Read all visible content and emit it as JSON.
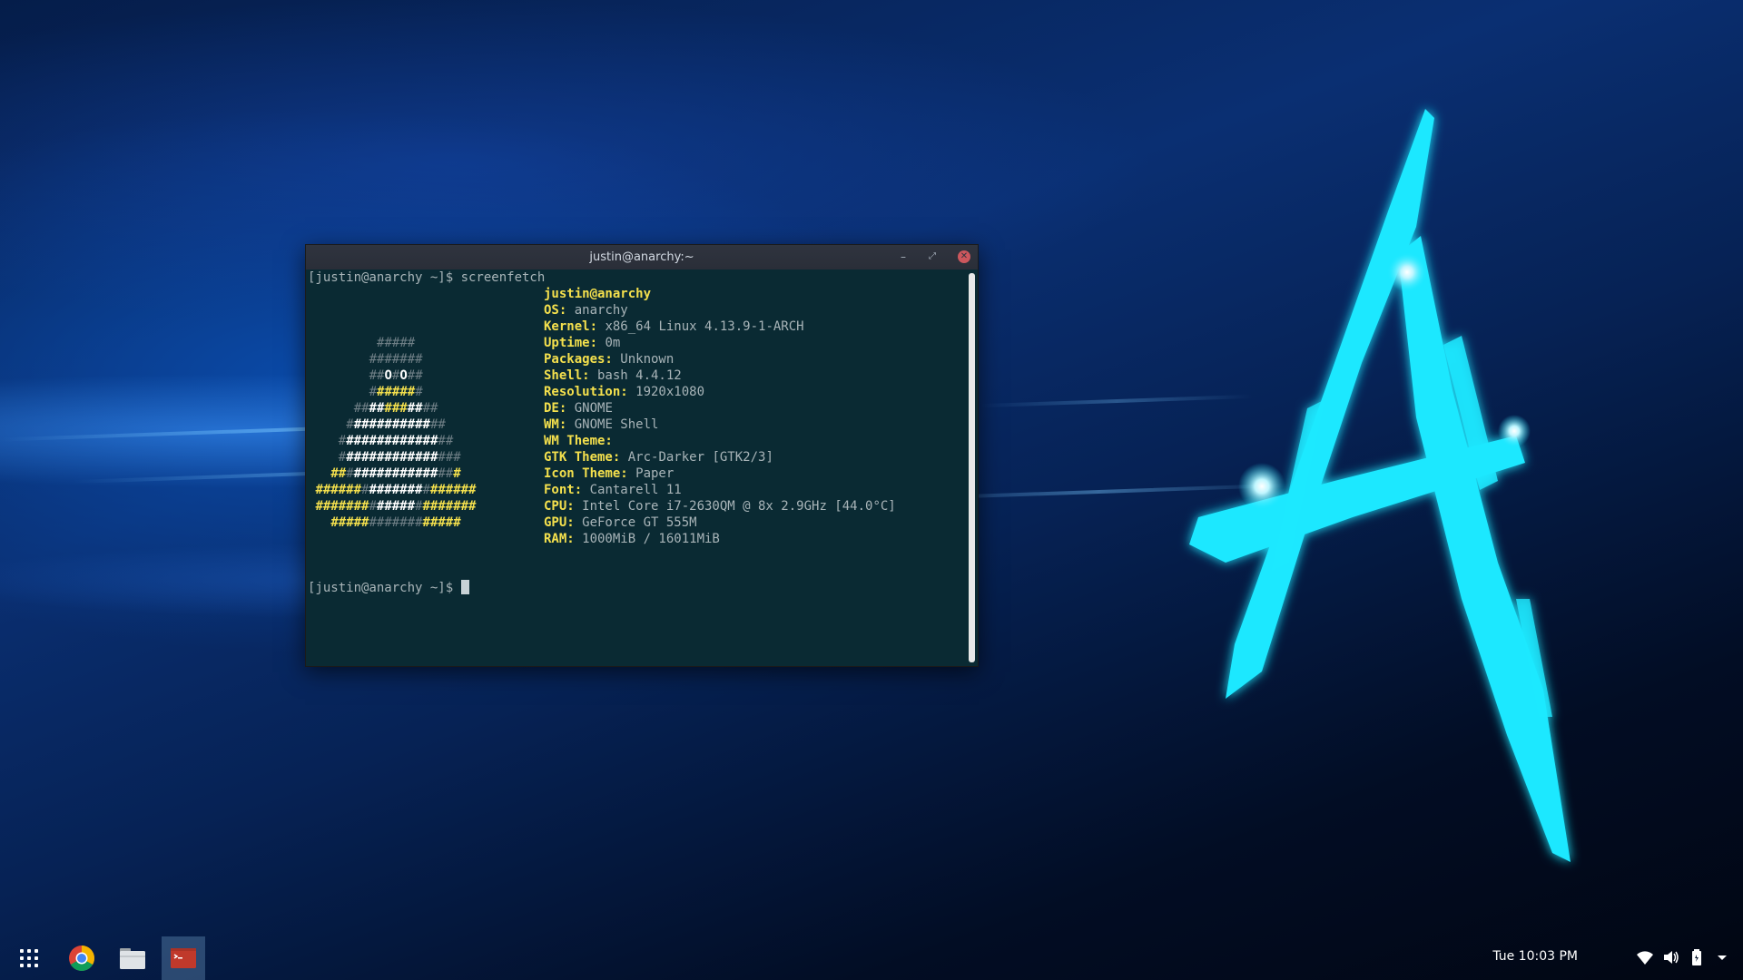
{
  "colors": {
    "terminal_bg": "#0a2a33",
    "titlebar_bg": "#2f343f",
    "key_yellow": "#f4e04d",
    "value_gray": "#a8b4b8",
    "close_red": "#cc575d",
    "logo_cyan": "#1ee8ff"
  },
  "terminal": {
    "title": "justin@anarchy:~",
    "prompt1": "[justin@anarchy ~]$ screenfetch",
    "prompt2": "[justin@anarchy ~]$ ",
    "header": "justin@anarchy",
    "info": [
      {
        "key": "OS:",
        "value": " anarchy"
      },
      {
        "key": "Kernel:",
        "value": " x86_64 Linux 4.13.9-1-ARCH"
      },
      {
        "key": "Uptime:",
        "value": " 0m"
      },
      {
        "key": "Packages:",
        "value": " Unknown"
      },
      {
        "key": "Shell:",
        "value": " bash 4.4.12"
      },
      {
        "key": "Resolution:",
        "value": " 1920x1080"
      },
      {
        "key": "DE:",
        "value": " GNOME"
      },
      {
        "key": "WM:",
        "value": " GNOME Shell"
      },
      {
        "key": "WM Theme:",
        "value": ""
      },
      {
        "key": "GTK Theme:",
        "value": " Arc-Darker [GTK2/3]"
      },
      {
        "key": "Icon Theme:",
        "value": " Paper"
      },
      {
        "key": "Font:",
        "value": " Cantarell 11"
      },
      {
        "key": "CPU:",
        "value": " Intel Core i7-2630QM @ 8x 2.9GHz [44.0°C]"
      },
      {
        "key": "GPU:",
        "value": " GeForce GT 555M"
      },
      {
        "key": "RAM:",
        "value": " 1000MiB / 16011MiB"
      }
    ],
    "logo": [
      {
        "indent": 9,
        "segments": [
          [
            "g",
            "#####"
          ]
        ]
      },
      {
        "indent": 8,
        "segments": [
          [
            "g",
            "#######"
          ]
        ]
      },
      {
        "indent": 8,
        "segments": [
          [
            "g",
            "##"
          ],
          [
            "w",
            "O"
          ],
          [
            "g",
            "#"
          ],
          [
            "w",
            "O"
          ],
          [
            "g",
            "##"
          ]
        ]
      },
      {
        "indent": 8,
        "segments": [
          [
            "g",
            "#"
          ],
          [
            "y",
            "#####"
          ],
          [
            "g",
            "#"
          ]
        ]
      },
      {
        "indent": 6,
        "segments": [
          [
            "g",
            "##"
          ],
          [
            "w",
            "##"
          ],
          [
            "y",
            "###"
          ],
          [
            "w",
            "##"
          ],
          [
            "g",
            "##"
          ]
        ]
      },
      {
        "indent": 5,
        "segments": [
          [
            "g",
            "#"
          ],
          [
            "w",
            "##########"
          ],
          [
            "g",
            "##"
          ]
        ]
      },
      {
        "indent": 4,
        "segments": [
          [
            "g",
            "#"
          ],
          [
            "w",
            "############"
          ],
          [
            "g",
            "##"
          ]
        ]
      },
      {
        "indent": 4,
        "segments": [
          [
            "g",
            "#"
          ],
          [
            "w",
            "############"
          ],
          [
            "g",
            "###"
          ]
        ]
      },
      {
        "indent": 3,
        "segments": [
          [
            "y",
            "##"
          ],
          [
            "g",
            "#"
          ],
          [
            "w",
            "###########"
          ],
          [
            "g",
            "##"
          ],
          [
            "y",
            "#"
          ]
        ]
      },
      {
        "indent": 1,
        "segments": [
          [
            "y",
            "######"
          ],
          [
            "g",
            "#"
          ],
          [
            "w",
            "#######"
          ],
          [
            "g",
            "#"
          ],
          [
            "y",
            "######"
          ]
        ]
      },
      {
        "indent": 1,
        "segments": [
          [
            "y",
            "#######"
          ],
          [
            "g",
            "#"
          ],
          [
            "w",
            "#####"
          ],
          [
            "g",
            "#"
          ],
          [
            "y",
            "#######"
          ]
        ]
      },
      {
        "indent": 3,
        "segments": [
          [
            "y",
            "#####"
          ],
          [
            "g",
            "#######"
          ],
          [
            "y",
            "#####"
          ]
        ]
      }
    ],
    "window_buttons": {
      "minimize": "–",
      "maximize": "⤢",
      "close": "✕"
    }
  },
  "taskbar": {
    "clock": "Tue 10:03 PM",
    "apps": [
      {
        "name": "app-grid",
        "icon": "grid-icon"
      },
      {
        "name": "chrome",
        "icon": "chrome-icon"
      },
      {
        "name": "files",
        "icon": "folder-icon"
      },
      {
        "name": "terminal",
        "icon": "terminal-icon"
      }
    ],
    "tray": [
      {
        "icon": "wifi-icon"
      },
      {
        "icon": "volume-icon"
      },
      {
        "icon": "battery-icon"
      },
      {
        "icon": "chevron-down-icon"
      }
    ]
  }
}
